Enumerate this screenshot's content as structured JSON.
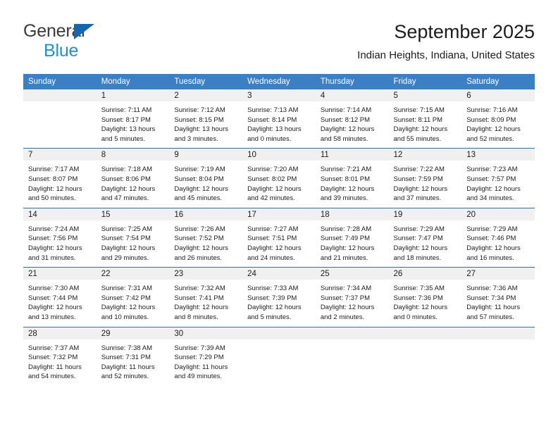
{
  "brand": {
    "name_part1": "General",
    "name_part2": "Blue"
  },
  "header": {
    "title": "September 2025",
    "subtitle": "Indian Heights, Indiana, United States"
  },
  "colors": {
    "header_blue": "#3b7fc4",
    "row_divider_blue": "#2f6fae",
    "daynum_band": "#f0f0f0",
    "brand_blue": "#1a8fe0",
    "brand_triangle": "#1267b2"
  },
  "weekday_headers": [
    "Sunday",
    "Monday",
    "Tuesday",
    "Wednesday",
    "Thursday",
    "Friday",
    "Saturday"
  ],
  "weeks": [
    [
      {
        "day": "",
        "sunrise": "",
        "sunset": "",
        "daylight": ""
      },
      {
        "day": "1",
        "sunrise": "Sunrise: 7:11 AM",
        "sunset": "Sunset: 8:17 PM",
        "daylight": "Daylight: 13 hours and 5 minutes."
      },
      {
        "day": "2",
        "sunrise": "Sunrise: 7:12 AM",
        "sunset": "Sunset: 8:15 PM",
        "daylight": "Daylight: 13 hours and 3 minutes."
      },
      {
        "day": "3",
        "sunrise": "Sunrise: 7:13 AM",
        "sunset": "Sunset: 8:14 PM",
        "daylight": "Daylight: 13 hours and 0 minutes."
      },
      {
        "day": "4",
        "sunrise": "Sunrise: 7:14 AM",
        "sunset": "Sunset: 8:12 PM",
        "daylight": "Daylight: 12 hours and 58 minutes."
      },
      {
        "day": "5",
        "sunrise": "Sunrise: 7:15 AM",
        "sunset": "Sunset: 8:11 PM",
        "daylight": "Daylight: 12 hours and 55 minutes."
      },
      {
        "day": "6",
        "sunrise": "Sunrise: 7:16 AM",
        "sunset": "Sunset: 8:09 PM",
        "daylight": "Daylight: 12 hours and 52 minutes."
      }
    ],
    [
      {
        "day": "7",
        "sunrise": "Sunrise: 7:17 AM",
        "sunset": "Sunset: 8:07 PM",
        "daylight": "Daylight: 12 hours and 50 minutes."
      },
      {
        "day": "8",
        "sunrise": "Sunrise: 7:18 AM",
        "sunset": "Sunset: 8:06 PM",
        "daylight": "Daylight: 12 hours and 47 minutes."
      },
      {
        "day": "9",
        "sunrise": "Sunrise: 7:19 AM",
        "sunset": "Sunset: 8:04 PM",
        "daylight": "Daylight: 12 hours and 45 minutes."
      },
      {
        "day": "10",
        "sunrise": "Sunrise: 7:20 AM",
        "sunset": "Sunset: 8:02 PM",
        "daylight": "Daylight: 12 hours and 42 minutes."
      },
      {
        "day": "11",
        "sunrise": "Sunrise: 7:21 AM",
        "sunset": "Sunset: 8:01 PM",
        "daylight": "Daylight: 12 hours and 39 minutes."
      },
      {
        "day": "12",
        "sunrise": "Sunrise: 7:22 AM",
        "sunset": "Sunset: 7:59 PM",
        "daylight": "Daylight: 12 hours and 37 minutes."
      },
      {
        "day": "13",
        "sunrise": "Sunrise: 7:23 AM",
        "sunset": "Sunset: 7:57 PM",
        "daylight": "Daylight: 12 hours and 34 minutes."
      }
    ],
    [
      {
        "day": "14",
        "sunrise": "Sunrise: 7:24 AM",
        "sunset": "Sunset: 7:56 PM",
        "daylight": "Daylight: 12 hours and 31 minutes."
      },
      {
        "day": "15",
        "sunrise": "Sunrise: 7:25 AM",
        "sunset": "Sunset: 7:54 PM",
        "daylight": "Daylight: 12 hours and 29 minutes."
      },
      {
        "day": "16",
        "sunrise": "Sunrise: 7:26 AM",
        "sunset": "Sunset: 7:52 PM",
        "daylight": "Daylight: 12 hours and 26 minutes."
      },
      {
        "day": "17",
        "sunrise": "Sunrise: 7:27 AM",
        "sunset": "Sunset: 7:51 PM",
        "daylight": "Daylight: 12 hours and 24 minutes."
      },
      {
        "day": "18",
        "sunrise": "Sunrise: 7:28 AM",
        "sunset": "Sunset: 7:49 PM",
        "daylight": "Daylight: 12 hours and 21 minutes."
      },
      {
        "day": "19",
        "sunrise": "Sunrise: 7:29 AM",
        "sunset": "Sunset: 7:47 PM",
        "daylight": "Daylight: 12 hours and 18 minutes."
      },
      {
        "day": "20",
        "sunrise": "Sunrise: 7:29 AM",
        "sunset": "Sunset: 7:46 PM",
        "daylight": "Daylight: 12 hours and 16 minutes."
      }
    ],
    [
      {
        "day": "21",
        "sunrise": "Sunrise: 7:30 AM",
        "sunset": "Sunset: 7:44 PM",
        "daylight": "Daylight: 12 hours and 13 minutes."
      },
      {
        "day": "22",
        "sunrise": "Sunrise: 7:31 AM",
        "sunset": "Sunset: 7:42 PM",
        "daylight": "Daylight: 12 hours and 10 minutes."
      },
      {
        "day": "23",
        "sunrise": "Sunrise: 7:32 AM",
        "sunset": "Sunset: 7:41 PM",
        "daylight": "Daylight: 12 hours and 8 minutes."
      },
      {
        "day": "24",
        "sunrise": "Sunrise: 7:33 AM",
        "sunset": "Sunset: 7:39 PM",
        "daylight": "Daylight: 12 hours and 5 minutes."
      },
      {
        "day": "25",
        "sunrise": "Sunrise: 7:34 AM",
        "sunset": "Sunset: 7:37 PM",
        "daylight": "Daylight: 12 hours and 2 minutes."
      },
      {
        "day": "26",
        "sunrise": "Sunrise: 7:35 AM",
        "sunset": "Sunset: 7:36 PM",
        "daylight": "Daylight: 12 hours and 0 minutes."
      },
      {
        "day": "27",
        "sunrise": "Sunrise: 7:36 AM",
        "sunset": "Sunset: 7:34 PM",
        "daylight": "Daylight: 11 hours and 57 minutes."
      }
    ],
    [
      {
        "day": "28",
        "sunrise": "Sunrise: 7:37 AM",
        "sunset": "Sunset: 7:32 PM",
        "daylight": "Daylight: 11 hours and 54 minutes."
      },
      {
        "day": "29",
        "sunrise": "Sunrise: 7:38 AM",
        "sunset": "Sunset: 7:31 PM",
        "daylight": "Daylight: 11 hours and 52 minutes."
      },
      {
        "day": "30",
        "sunrise": "Sunrise: 7:39 AM",
        "sunset": "Sunset: 7:29 PM",
        "daylight": "Daylight: 11 hours and 49 minutes."
      },
      {
        "day": "",
        "sunrise": "",
        "sunset": "",
        "daylight": ""
      },
      {
        "day": "",
        "sunrise": "",
        "sunset": "",
        "daylight": ""
      },
      {
        "day": "",
        "sunrise": "",
        "sunset": "",
        "daylight": ""
      },
      {
        "day": "",
        "sunrise": "",
        "sunset": "",
        "daylight": ""
      }
    ]
  ]
}
